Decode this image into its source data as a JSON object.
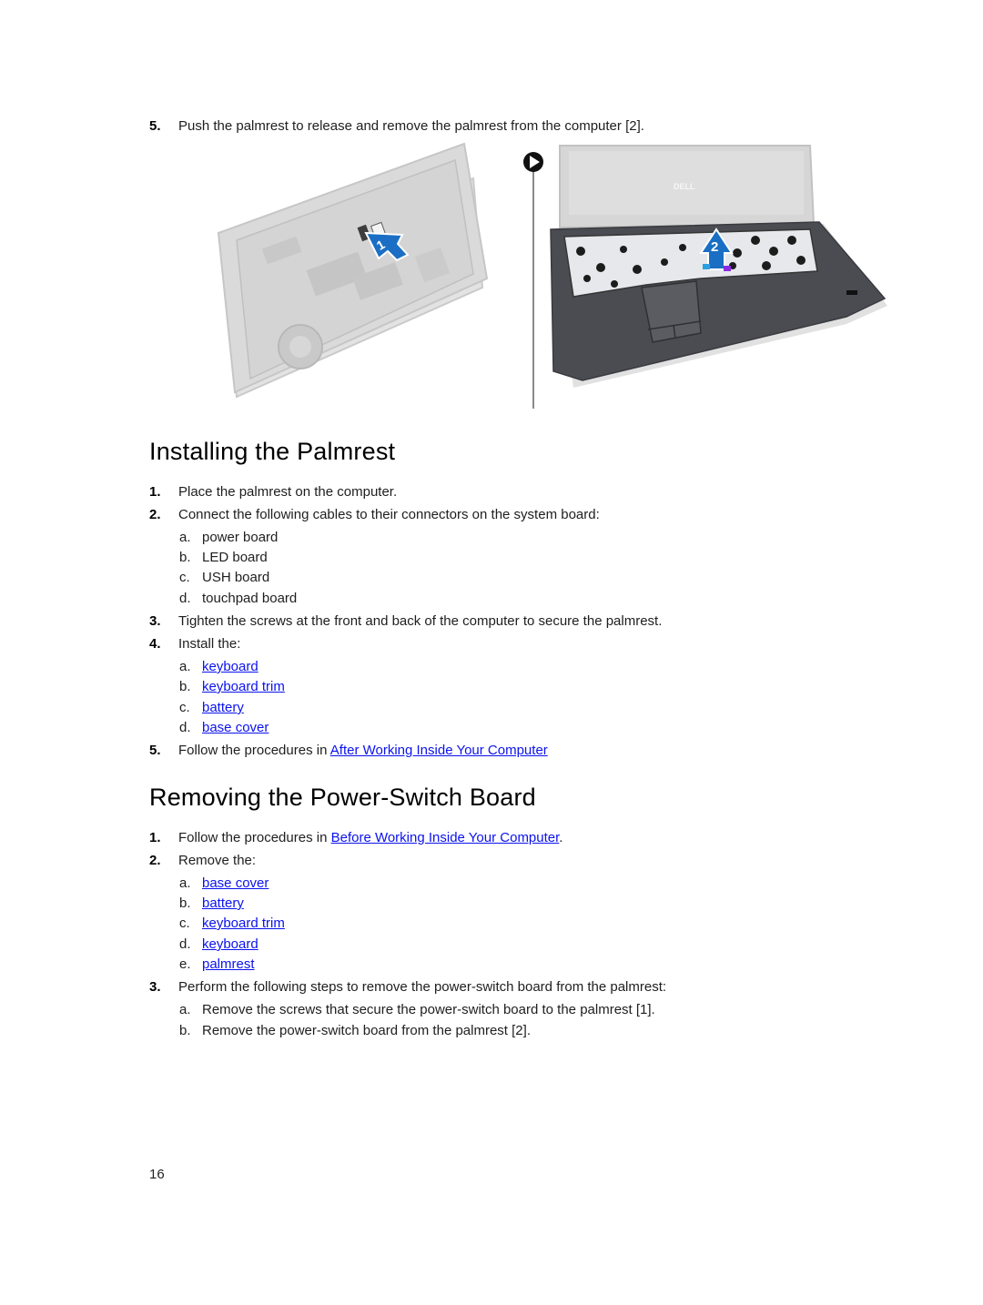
{
  "removing_palmrest_tail": {
    "step5": {
      "num": "5.",
      "text": "Push the palmrest to release and remove the palmrest from the computer [2]."
    }
  },
  "figure": {
    "callout_1": "1",
    "callout_2": "2",
    "brand_label": "DELL",
    "colors": {
      "callout": "#1a6fc4",
      "laptop_dark": "#4a4c52",
      "laptop_light": "#d8d8d8"
    }
  },
  "installing": {
    "title": "Installing the Palmrest",
    "steps": [
      {
        "num": "1.",
        "text": "Place the palmrest on the computer."
      },
      {
        "num": "2.",
        "text": "Connect the following cables to their connectors on the system board:",
        "subs": [
          {
            "letter": "a.",
            "text": "power board"
          },
          {
            "letter": "b.",
            "text": "LED board"
          },
          {
            "letter": "c.",
            "text": "USH board"
          },
          {
            "letter": "d.",
            "text": "touchpad board"
          }
        ]
      },
      {
        "num": "3.",
        "text": "Tighten the screws at the front and back of the computer to secure the palmrest."
      },
      {
        "num": "4.",
        "text": "Install the:",
        "subs": [
          {
            "letter": "a.",
            "link": "keyboard"
          },
          {
            "letter": "b.",
            "link": "keyboard trim"
          },
          {
            "letter": "c.",
            "link": "battery"
          },
          {
            "letter": "d.",
            "link": "base cover"
          }
        ]
      },
      {
        "num": "5.",
        "text": "Follow the procedures in ",
        "link": "After Working Inside Your Computer"
      }
    ]
  },
  "removing_switch": {
    "title": "Removing the Power-Switch Board",
    "steps": [
      {
        "num": "1.",
        "text": "Follow the procedures in ",
        "link": "Before Working Inside Your Computer",
        "suffix": "."
      },
      {
        "num": "2.",
        "text": "Remove the:",
        "subs": [
          {
            "letter": "a.",
            "link": "base cover"
          },
          {
            "letter": "b.",
            "link": "battery"
          },
          {
            "letter": "c.",
            "link": "keyboard trim"
          },
          {
            "letter": "d.",
            "link": "keyboard"
          },
          {
            "letter": "e.",
            "link": "palmrest"
          }
        ]
      },
      {
        "num": "3.",
        "text": "Perform the following steps to remove the power-switch board from the palmrest:",
        "subs": [
          {
            "letter": "a.",
            "text": "Remove the screws that secure the power-switch board to the palmrest [1]."
          },
          {
            "letter": "b.",
            "text": "Remove the power-switch board from the palmrest [2]."
          }
        ]
      }
    ]
  },
  "footer": {
    "page_number": "16"
  }
}
